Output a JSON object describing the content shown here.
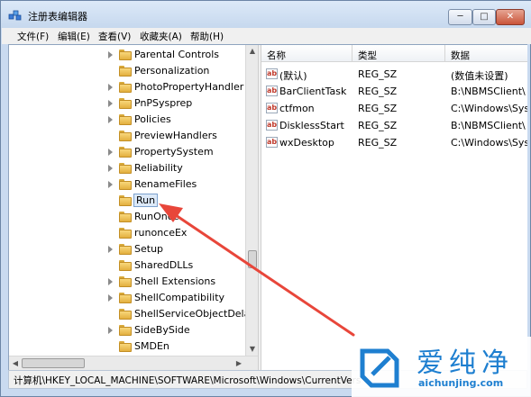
{
  "window": {
    "title": "注册表编辑器",
    "controls": {
      "minimize": "─",
      "maximize": "□",
      "close": "✕"
    }
  },
  "menu": [
    "文件(F)",
    "编辑(E)",
    "查看(V)",
    "收藏夹(A)",
    "帮助(H)"
  ],
  "tree": {
    "items": [
      {
        "label": "Parental Controls",
        "expandable": true
      },
      {
        "label": "Personalization",
        "expandable": false
      },
      {
        "label": "PhotoPropertyHandler",
        "expandable": true
      },
      {
        "label": "PnPSysprep",
        "expandable": true
      },
      {
        "label": "Policies",
        "expandable": true
      },
      {
        "label": "PreviewHandlers",
        "expandable": false
      },
      {
        "label": "PropertySystem",
        "expandable": true
      },
      {
        "label": "Reliability",
        "expandable": true
      },
      {
        "label": "RenameFiles",
        "expandable": true
      },
      {
        "label": "Run",
        "expandable": false,
        "selected": true
      },
      {
        "label": "RunOnce",
        "expandable": false
      },
      {
        "label": "runonceEx",
        "expandable": false
      },
      {
        "label": "Setup",
        "expandable": true
      },
      {
        "label": "SharedDLLs",
        "expandable": false
      },
      {
        "label": "Shell Extensions",
        "expandable": true
      },
      {
        "label": "ShellCompatibility",
        "expandable": true
      },
      {
        "label": "ShellServiceObjectDelayL",
        "expandable": false
      },
      {
        "label": "SideBySide",
        "expandable": true
      },
      {
        "label": "SMDEn",
        "expandable": false
      }
    ]
  },
  "list": {
    "columns": {
      "name": "名称",
      "type": "类型",
      "data": "数据"
    },
    "rows": [
      {
        "name": "(默认)",
        "type": "REG_SZ",
        "data": "(数值未设置)"
      },
      {
        "name": "BarClientTask",
        "type": "REG_SZ",
        "data": "B:\\NBMSClient\\"
      },
      {
        "name": "ctfmon",
        "type": "REG_SZ",
        "data": "C:\\Windows\\Sys"
      },
      {
        "name": "DisklessStart",
        "type": "REG_SZ",
        "data": "B:\\NBMSClient\\"
      },
      {
        "name": "wxDesktop",
        "type": "REG_SZ",
        "data": "C:\\Windows\\Sys"
      }
    ]
  },
  "status": "计算机\\HKEY_LOCAL_MACHINE\\SOFTWARE\\Microsoft\\Windows\\CurrentVers",
  "watermark": {
    "title": "爱纯净",
    "url": "aichunjing.com"
  },
  "colors": {
    "annotation_arrow": "#e8463a",
    "watermark": "#1e7fd0",
    "folder": "#f2c75c"
  }
}
